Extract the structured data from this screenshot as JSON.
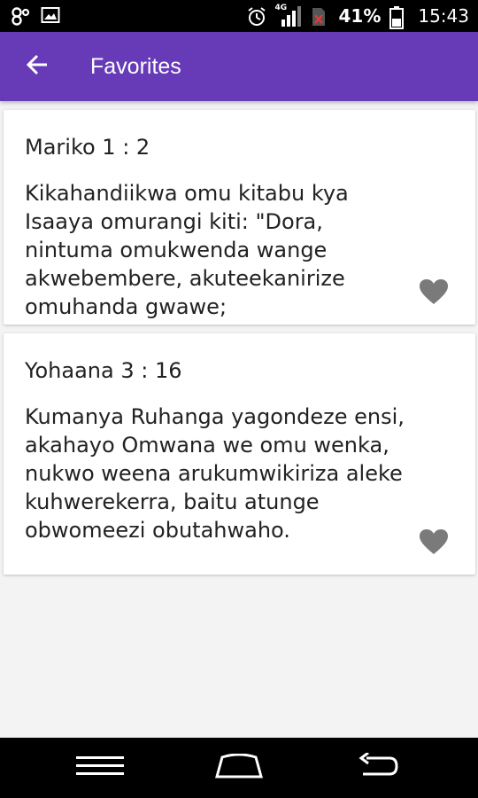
{
  "status_bar": {
    "battery_percent": "41%",
    "time": "15:43",
    "network": "4G",
    "icons": [
      "notification-icon",
      "image-icon",
      "alarm-icon",
      "signal-icon",
      "no-sim-icon",
      "battery-icon"
    ]
  },
  "app_bar": {
    "title": "Favorites",
    "back_icon": "arrow-back-icon",
    "color": "#673ab7"
  },
  "favorites": [
    {
      "reference": "Mariko 1 : 2",
      "text": "Kikahandiikwa omu kitabu kya Isaaya omurangi kiti: \"Dora, nintuma omukwenda wange akwebembere, akuteekanirize omuhanda gwawe;",
      "icon": "heart-icon"
    },
    {
      "reference": "Yohaana 3 : 16",
      "text": "Kumanya Ruhanga yagondeze ensi, akahayo Omwana we omu wenka, nukwo weena arukumwikiriza aleke kuhwerekerra, baitu atunge obwomeezi obutahwaho.",
      "icon": "heart-icon"
    }
  ],
  "nav_bar": {
    "icons": [
      "menu-icon",
      "home-icon",
      "back-icon"
    ]
  }
}
